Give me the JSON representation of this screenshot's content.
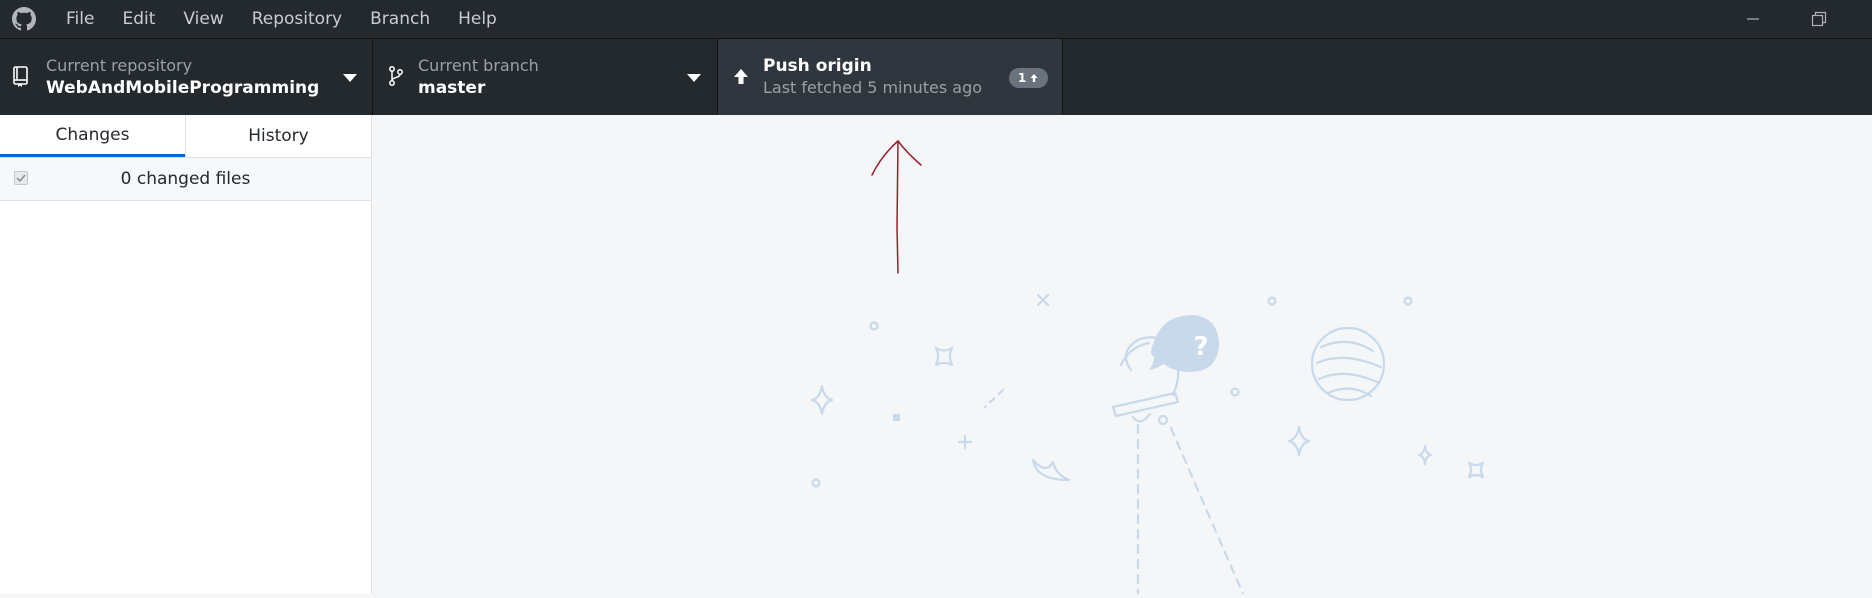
{
  "menu": {
    "items": [
      {
        "id": "file",
        "label": "File"
      },
      {
        "id": "edit",
        "label": "Edit"
      },
      {
        "id": "view",
        "label": "View"
      },
      {
        "id": "repository",
        "label": "Repository"
      },
      {
        "id": "branch",
        "label": "Branch"
      },
      {
        "id": "help",
        "label": "Help"
      }
    ]
  },
  "toolbar": {
    "repository": {
      "title": "Current repository",
      "value": "WebAndMobileProgramming"
    },
    "branch": {
      "title": "Current branch",
      "value": "master"
    },
    "push": {
      "title": "Push origin",
      "subtitle": "Last fetched 5 minutes ago",
      "ahead_count": "1"
    }
  },
  "sidebar": {
    "tabs": [
      {
        "id": "changes",
        "label": "Changes",
        "selected": true
      },
      {
        "id": "history",
        "label": "History",
        "selected": false
      }
    ],
    "changed_files_label": "0 changed files",
    "select_all_checked": true
  },
  "colors": {
    "chrome": "#24292e",
    "push_highlight": "#2f363d",
    "tab_accent": "#0366d6",
    "illustration": "#c7d9ea",
    "annotation_arrow": "#9b1f2b"
  },
  "icons": {
    "app": "github-logo-icon",
    "repository": "repo-icon",
    "branch": "git-branch-icon",
    "push": "arrow-up-icon",
    "minimize": "minimize-icon",
    "restore": "restore-icon"
  }
}
